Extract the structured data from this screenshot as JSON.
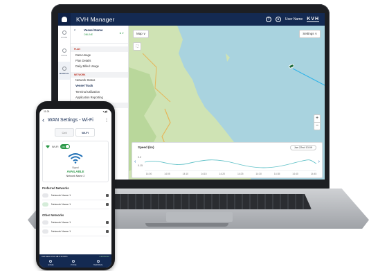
{
  "app": {
    "title": "KVH Manager",
    "help_icon": "question-icon",
    "user_name": "User Name",
    "brand": "KVH"
  },
  "rail": {
    "items": [
      {
        "label": "HOME",
        "icon": "home-icon"
      },
      {
        "label": "VOICE",
        "icon": "phone-icon"
      },
      {
        "label": "TERMINAL",
        "icon": "terminal-icon"
      }
    ]
  },
  "vessel": {
    "name": "Vessel Name",
    "status": "ONLINE",
    "badge": "●  ∨"
  },
  "nav": {
    "sections": [
      {
        "heading": "PLAN",
        "items": [
          "Data Usage",
          "Plan Details",
          "Daily Billed Usage"
        ]
      },
      {
        "heading": "NETWORK",
        "items": [
          "Network Status",
          "Vessel Track",
          "Terminal Utilization",
          "Application Reporting"
        ]
      },
      {
        "heading": "TERMINAL",
        "items": []
      }
    ],
    "active_item": "Vessel Track"
  },
  "map": {
    "type_select": "Map",
    "settings_button": "Settings",
    "zoom_in": "+",
    "zoom_out": "−",
    "colors": {
      "sea": "#a9d3df",
      "land": "#cfe3b4",
      "track": "#2fb3e8",
      "ship": "#1e6a3a"
    }
  },
  "speed_panel": {
    "title": "Speed (kn)",
    "date": "Jan 22nd 13:09",
    "y_ticks": [
      "0.2",
      "0.15"
    ],
    "x_ticks": [
      "14:00",
      "14:05",
      "14:10",
      "14:15",
      "14:20",
      "14:25",
      "14:30",
      "14:35",
      "14:40",
      "14:45"
    ],
    "prev": "‹",
    "next": "›"
  },
  "phone": {
    "status_time": "11:24",
    "status_icons": "▾◢▮",
    "title": "WAN Settings - Wi-Fi",
    "tabs": [
      "Cell",
      "Wi-Fi"
    ],
    "active_tab": "Wi-Fi",
    "wifi_label": "Wi-Fi",
    "wifi_toggle": "ON",
    "signal_label": "Signal",
    "signal_value": "AVAILABLE",
    "connected_network": "Network Name 2",
    "preferred_heading": "Preferred Networks",
    "preferred": [
      "Network Name 1",
      "Network Name 1"
    ],
    "other_heading": "Other Networks",
    "other": [
      "Network Name 1",
      "Network Name 1"
    ],
    "footer_status_left": "Cell status   Vl 21 dB  ▾ 13 WTS",
    "footer_status_right": "1.35 PM Ru",
    "bottom_nav": [
      "HOME",
      "VOICE",
      "TERMINAL"
    ]
  }
}
